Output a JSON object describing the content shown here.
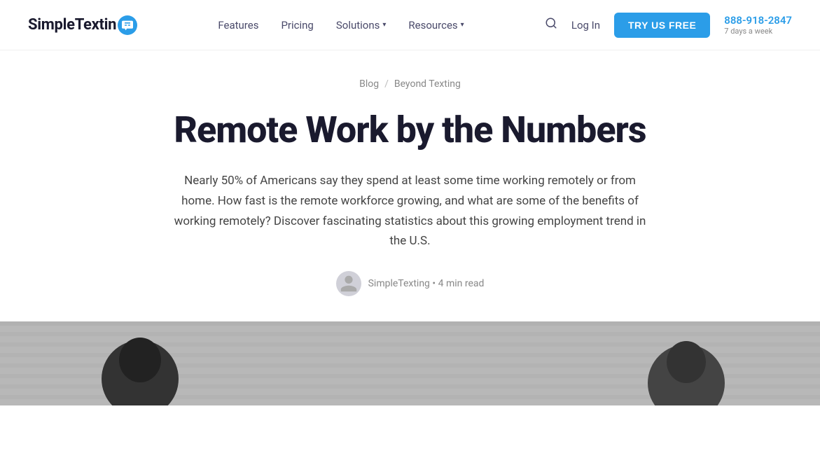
{
  "header": {
    "logo": {
      "text_plain": "SimpleTexting",
      "bold_part": "Simple",
      "regular_part": "Texting"
    },
    "nav": {
      "features_label": "Features",
      "pricing_label": "Pricing",
      "solutions_label": "Solutions",
      "resources_label": "Resources",
      "login_label": "Log In",
      "try_btn_label": "TRY US FREE"
    },
    "phone": {
      "number": "888-918-2847",
      "subtitle": "7 days a week"
    }
  },
  "breadcrumb": {
    "blog_label": "Blog",
    "separator": "/",
    "current_label": "Beyond Texting"
  },
  "article": {
    "title": "Remote Work by the Numbers",
    "subtitle": "Nearly 50% of Americans say they spend at least some time working remotely or from home. How fast is the remote workforce growing, and what are some of the benefits of working remotely? Discover fascinating statistics about this growing employment trend in the U.S.",
    "author_name": "SimpleTexting",
    "read_time": "4 min read",
    "author_separator": "•"
  }
}
